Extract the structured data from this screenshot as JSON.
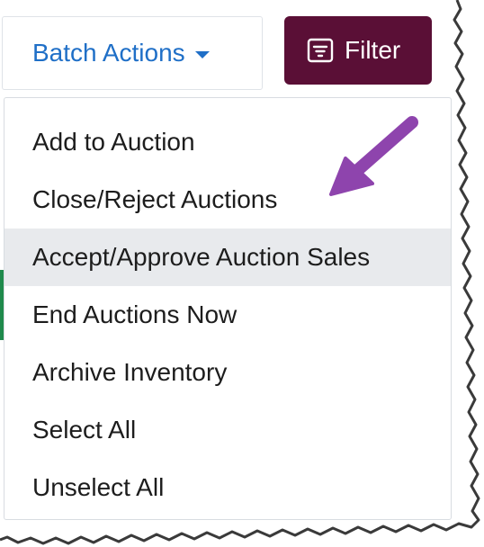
{
  "toolbar": {
    "batch_actions_label": "Batch Actions",
    "filter_label": "Filter"
  },
  "menu": {
    "items": [
      {
        "label": "Add to Auction",
        "highlighted": false
      },
      {
        "label": "Close/Reject Auctions",
        "highlighted": false
      },
      {
        "label": "Accept/Approve Auction Sales",
        "highlighted": true
      },
      {
        "label": "End Auctions Now",
        "highlighted": false
      },
      {
        "label": "Archive Inventory",
        "highlighted": false
      },
      {
        "label": "Select All",
        "highlighted": false
      },
      {
        "label": "Unselect All",
        "highlighted": false
      }
    ]
  },
  "colors": {
    "link_blue": "#1f6fc7",
    "filter_bg": "#5a0f36",
    "highlight_bg": "#e8eaed",
    "annotation_arrow": "#8e44ad",
    "side_accent": "#1f8a4c"
  },
  "icons": {
    "filter": "filter-icon",
    "caret": "caret-down-icon",
    "annotation": "arrow-icon"
  }
}
